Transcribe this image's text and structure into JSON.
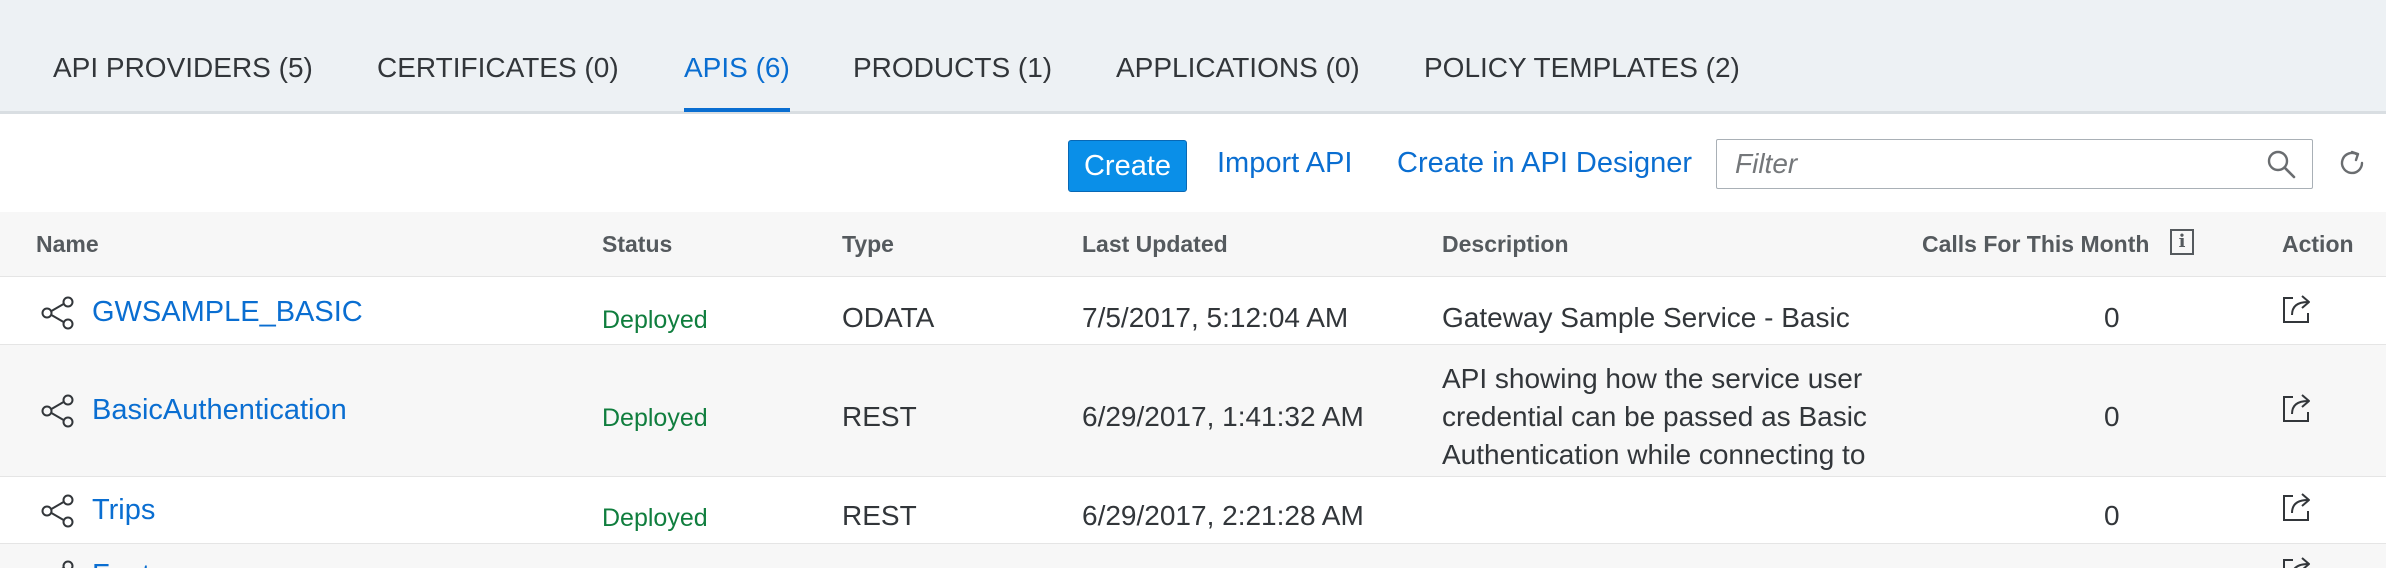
{
  "tabs": [
    {
      "label": "API PROVIDERS (5)"
    },
    {
      "label": "CERTIFICATES (0)"
    },
    {
      "label": "APIS (6)"
    },
    {
      "label": "PRODUCTS (1)"
    },
    {
      "label": "APPLICATIONS (0)"
    },
    {
      "label": "POLICY TEMPLATES (2)"
    }
  ],
  "toolbar": {
    "create_label": "Create",
    "import_label": "Import API",
    "designer_label": "Create in API Designer",
    "filter_placeholder": "Filter"
  },
  "table": {
    "headers": {
      "name": "Name",
      "status": "Status",
      "type": "Type",
      "last_updated": "Last Updated",
      "description": "Description",
      "calls": "Calls For This Month",
      "action": "Action"
    },
    "rows": [
      {
        "name": "GWSAMPLE_BASIC",
        "status": "Deployed",
        "type": "ODATA",
        "last_updated": "7/5/2017, 5:12:04 AM",
        "description": "Gateway Sample Service - Basic",
        "calls": "0"
      },
      {
        "name": "BasicAuthentication",
        "status": "Deployed",
        "type": "REST",
        "last_updated": "6/29/2017, 1:41:32 AM",
        "description": "API showing how the service user credential can be passed as Basic Authentication while connecting to",
        "calls": "0"
      },
      {
        "name": "Trips",
        "status": "Deployed",
        "type": "REST",
        "last_updated": "6/29/2017, 2:21:28 AM",
        "description": "",
        "calls": "0"
      },
      {
        "name": "Fonts",
        "status": "",
        "type": "",
        "last_updated": "",
        "description": "",
        "calls": ""
      }
    ]
  },
  "colors": {
    "accent": "#0a6ed1",
    "status_deployed": "#107e3e",
    "tabbar_bg": "#edf1f4"
  },
  "icons": {
    "row_icon": "share-icon",
    "action_icon": "external-link-icon",
    "search": "search-icon",
    "refresh": "refresh-icon",
    "info": "info-icon"
  }
}
